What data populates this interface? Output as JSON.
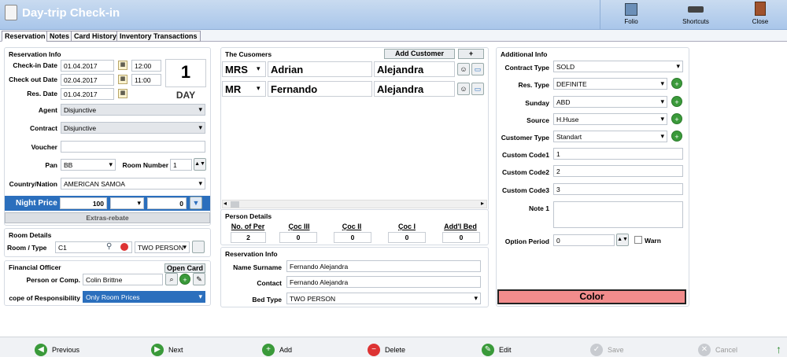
{
  "window": {
    "title": "Day-trip Check-in"
  },
  "toolbar": {
    "folio": "Folio",
    "shortcuts": "Shortcuts",
    "close": "Close"
  },
  "tabs": [
    "Reservation",
    "Notes",
    "Card History",
    "Inventory Transactions"
  ],
  "reservation_info": {
    "title": "Reservation Info",
    "checkin_label": "Check-in Date",
    "checkin_date": "01.04.2017",
    "checkin_time": "12:00",
    "checkout_label": "Check out Date",
    "checkout_date": "02.04.2017",
    "checkout_time": "11:00",
    "resdate_label": "Res. Date",
    "res_date": "01.04.2017",
    "day_count": "1",
    "day_label": "DAY",
    "agent_label": "Agent",
    "agent": "Disjunctive",
    "contract_label": "Contract",
    "contract": "Disjunctive",
    "voucher_label": "Voucher",
    "voucher": "",
    "pan_label": "Pan",
    "pan": "BB",
    "room_number_label": "Room Number",
    "room_number": "1",
    "country_label": "Country/Nation",
    "country": "AMERICAN SAMOA",
    "night_price_label": "Night Price",
    "night_price": "100",
    "night_price_2": "0",
    "extras": "Extras-rebate"
  },
  "room_details": {
    "title": "Room Details",
    "room_type_label": "Room / Type",
    "room": "C1",
    "type": "TWO PERSON"
  },
  "financial": {
    "title": "Financial Officer",
    "open_card": "Open Card",
    "person_label": "Person or Comp.",
    "person": "Colin Brittne",
    "scope_label": "cope of Responsibility",
    "scope": "Only Room Prices"
  },
  "customers": {
    "title": "The Cusomers",
    "add_button": "Add Customer",
    "plus_button": "+",
    "rows": [
      {
        "title": "MRS",
        "first": "Adrian",
        "last": "Alejandra"
      },
      {
        "title": "MR",
        "first": "Fernando",
        "last": "Alejandra"
      }
    ]
  },
  "person_details": {
    "title": "Person Details",
    "headers": [
      "No. of Per",
      "Çoc III",
      "Çoc II",
      "Çoc I",
      "Add'l Bed"
    ],
    "values": [
      "2",
      "0",
      "0",
      "0",
      "0"
    ]
  },
  "res_info2": {
    "title": "Reservation Info",
    "name_label": "Name Surname",
    "name": "Fernando  Alejandra",
    "contact_label": "Contact",
    "contact": "Fernando  Alejandra",
    "bed_label": "Bed Type",
    "bed": "TWO PERSON"
  },
  "additional": {
    "title": "Additional Info",
    "contract_type_label": "Contract Type",
    "contract_type": "SOLD",
    "res_type_label": "Res. Type",
    "res_type": "DEFINITE",
    "sunday_label": "Sunday",
    "sunday": "ABD",
    "source_label": "Source",
    "source": "H.Huse",
    "customer_type_label": "Customer Type",
    "customer_type": "Standart",
    "code1_label": "Custom Code1",
    "code1": "1",
    "code2_label": "Custom Code2",
    "code2": "2",
    "code3_label": "Custom Code3",
    "code3": "3",
    "note1_label": "Note 1",
    "note1": "",
    "option_label": "Option Period",
    "option": "0",
    "warn": "Warn",
    "color": "Color"
  },
  "bottom": {
    "previous": "Previous",
    "next": "Next",
    "add": "Add",
    "delete": "Delete",
    "edit": "Edit",
    "save": "Save",
    "cancel": "Cancel"
  }
}
